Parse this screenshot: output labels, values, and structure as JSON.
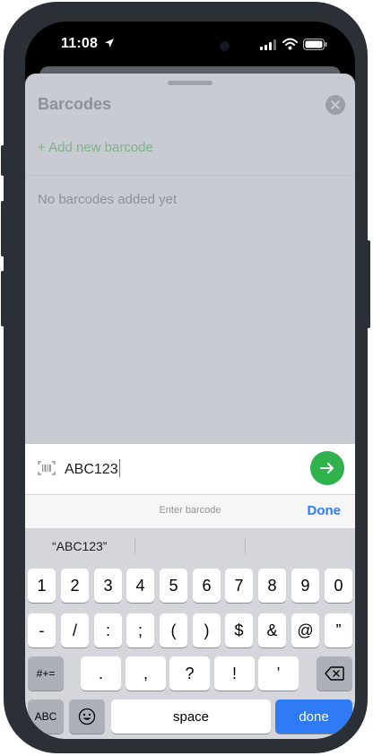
{
  "status_bar": {
    "time": "11:08"
  },
  "sheet": {
    "title": "Barcodes",
    "add_label": "+ Add new barcode",
    "empty_text": "No barcodes added yet"
  },
  "input": {
    "value": "ABC123"
  },
  "accessory": {
    "hint": "Enter barcode",
    "done_label": "Done"
  },
  "keyboard": {
    "suggestion": "“ABC123”",
    "row1": [
      "1",
      "2",
      "3",
      "4",
      "5",
      "6",
      "7",
      "8",
      "9",
      "0"
    ],
    "row2": [
      "-",
      "/",
      ":",
      ";",
      "(",
      ")",
      "$",
      "&",
      "@",
      "”"
    ],
    "row3": [
      ".",
      ",",
      "?",
      "!",
      "’"
    ],
    "symbols_label": "#+=",
    "abc_label": "ABC",
    "space_label": "space",
    "return_label": "done"
  },
  "colors": {
    "accent_blue": "#2f7bf6",
    "go_green": "#2fb24c",
    "add_green": "#7fb28a"
  }
}
